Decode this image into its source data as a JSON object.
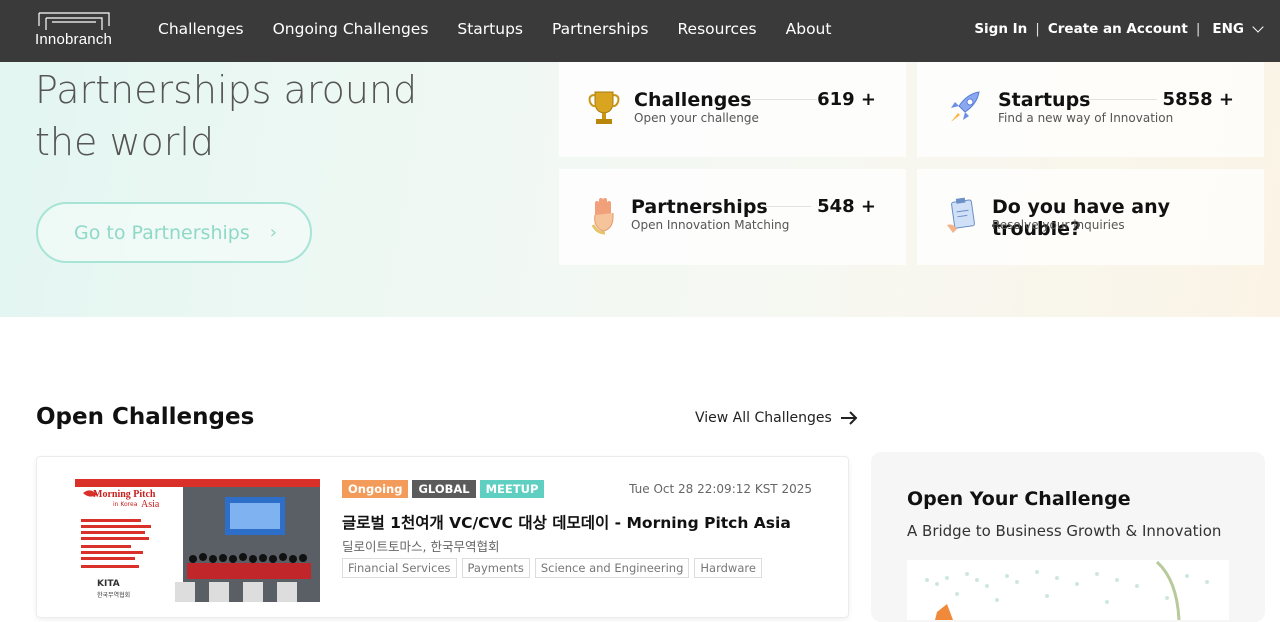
{
  "header": {
    "logo_text": "Innobranch",
    "nav": [
      "Challenges",
      "Ongoing Challenges",
      "Startups",
      "Partnerships",
      "Resources",
      "About"
    ],
    "sign_in": "Sign In",
    "separator": "|",
    "create_account": "Create an Account",
    "language": "ENG"
  },
  "hero": {
    "title": "Partnerships around the world",
    "button_label": "Go to Partnerships",
    "button_arrow": "›"
  },
  "stats": [
    {
      "title": "Challenges",
      "subtitle": "Open your challenge",
      "count": "619 +",
      "icon": "trophy-icon"
    },
    {
      "title": "Startups",
      "subtitle": "Find a new way of Innovation",
      "count": "5858 +",
      "icon": "rocket-icon"
    },
    {
      "title": "Partnerships",
      "subtitle": "Open Innovation Matching",
      "count": "548 +",
      "icon": "hand-icon"
    },
    {
      "title": "Do you have any trouble?",
      "subtitle": "Resolve your inquiries",
      "icon": "clipboard-icon"
    }
  ],
  "open_challenges": {
    "title": "Open Challenges",
    "view_all": "View All Challenges",
    "items": [
      {
        "tags": [
          {
            "label": "Ongoing",
            "color": "#f39b5a"
          },
          {
            "label": "GLOBAL",
            "color": "#5b5b5b"
          },
          {
            "label": "MEETUP",
            "color": "#5fcfc2"
          }
        ],
        "date": "Tue Oct 28 22:09:12 KST 2025",
        "title": "글로벌 1천여개 VC/CVC 대상 데모데이 - Morning Pitch Asia",
        "org": "딜로이트토마스, 한국무역협회",
        "categories": [
          "Financial Services",
          "Payments",
          "Science and Engineering",
          "Hardware"
        ],
        "thumb": {
          "brand": "Morning Pitch",
          "sub": "in Korea",
          "region": "Asia",
          "sponsor": "KITA",
          "sponsor_sub": "한국무역협회"
        }
      }
    ]
  },
  "side_card": {
    "title": "Open Your Challenge",
    "subtitle": "A Bridge to Business Growth & Innovation"
  }
}
